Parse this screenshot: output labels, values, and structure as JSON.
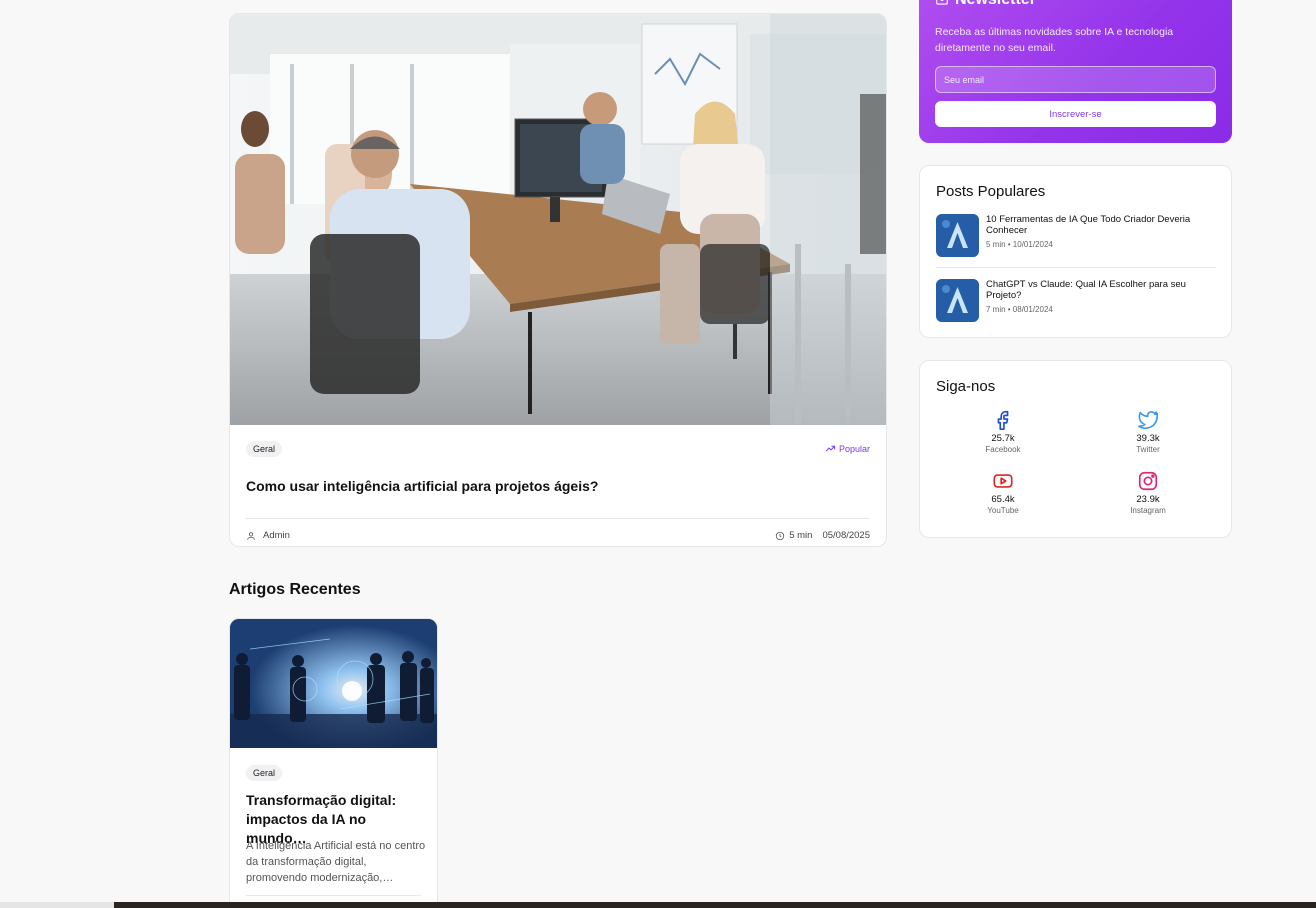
{
  "featured": {
    "tag": "Geral",
    "popular_label": "Popular",
    "title": "Como usar inteligência artificial para projetos ágeis?",
    "author": "Admin",
    "read_time": "5 min",
    "date": "05/08/2025"
  },
  "recent_section": {
    "title": "Artigos Recentes",
    "articles": [
      {
        "tag": "Geral",
        "title": "Transformação digital: impactos da IA no mundo…",
        "excerpt": "A Inteligência Artificial está no centro da transformação digital, promovendo modernização,…"
      }
    ]
  },
  "newsletter": {
    "title": "Newsletter",
    "text": "Receba as últimas novidades sobre IA e tecnologia diretamente no seu email.",
    "email_placeholder": "Seu email",
    "button_label": "Inscrever-se"
  },
  "popular_posts": {
    "title": "Posts Populares",
    "posts": [
      {
        "title": "10 Ferramentas de IA Que Todo Criador Deveria Conhecer",
        "meta": "5 min • 10/01/2024"
      },
      {
        "title": "ChatGPT vs Claude: Qual IA Escolher para seu Projeto?",
        "meta": "7 min • 08/01/2024"
      }
    ]
  },
  "follow": {
    "title": "Siga-nos",
    "networks": [
      {
        "icon": "facebook-icon",
        "count": "25.7k",
        "name": "Facebook",
        "color": "#1d4ed8"
      },
      {
        "icon": "twitter-icon",
        "count": "39.3k",
        "name": "Twitter",
        "color": "#3b9be8"
      },
      {
        "icon": "youtube-icon",
        "count": "65.4k",
        "name": "YouTube",
        "color": "#dc2626"
      },
      {
        "icon": "instagram-icon",
        "count": "23.9k",
        "name": "Instagram",
        "color": "#db2777"
      }
    ]
  },
  "colors": {
    "accent": "#7c3aed",
    "newsletter_bg": "#9333ea"
  }
}
